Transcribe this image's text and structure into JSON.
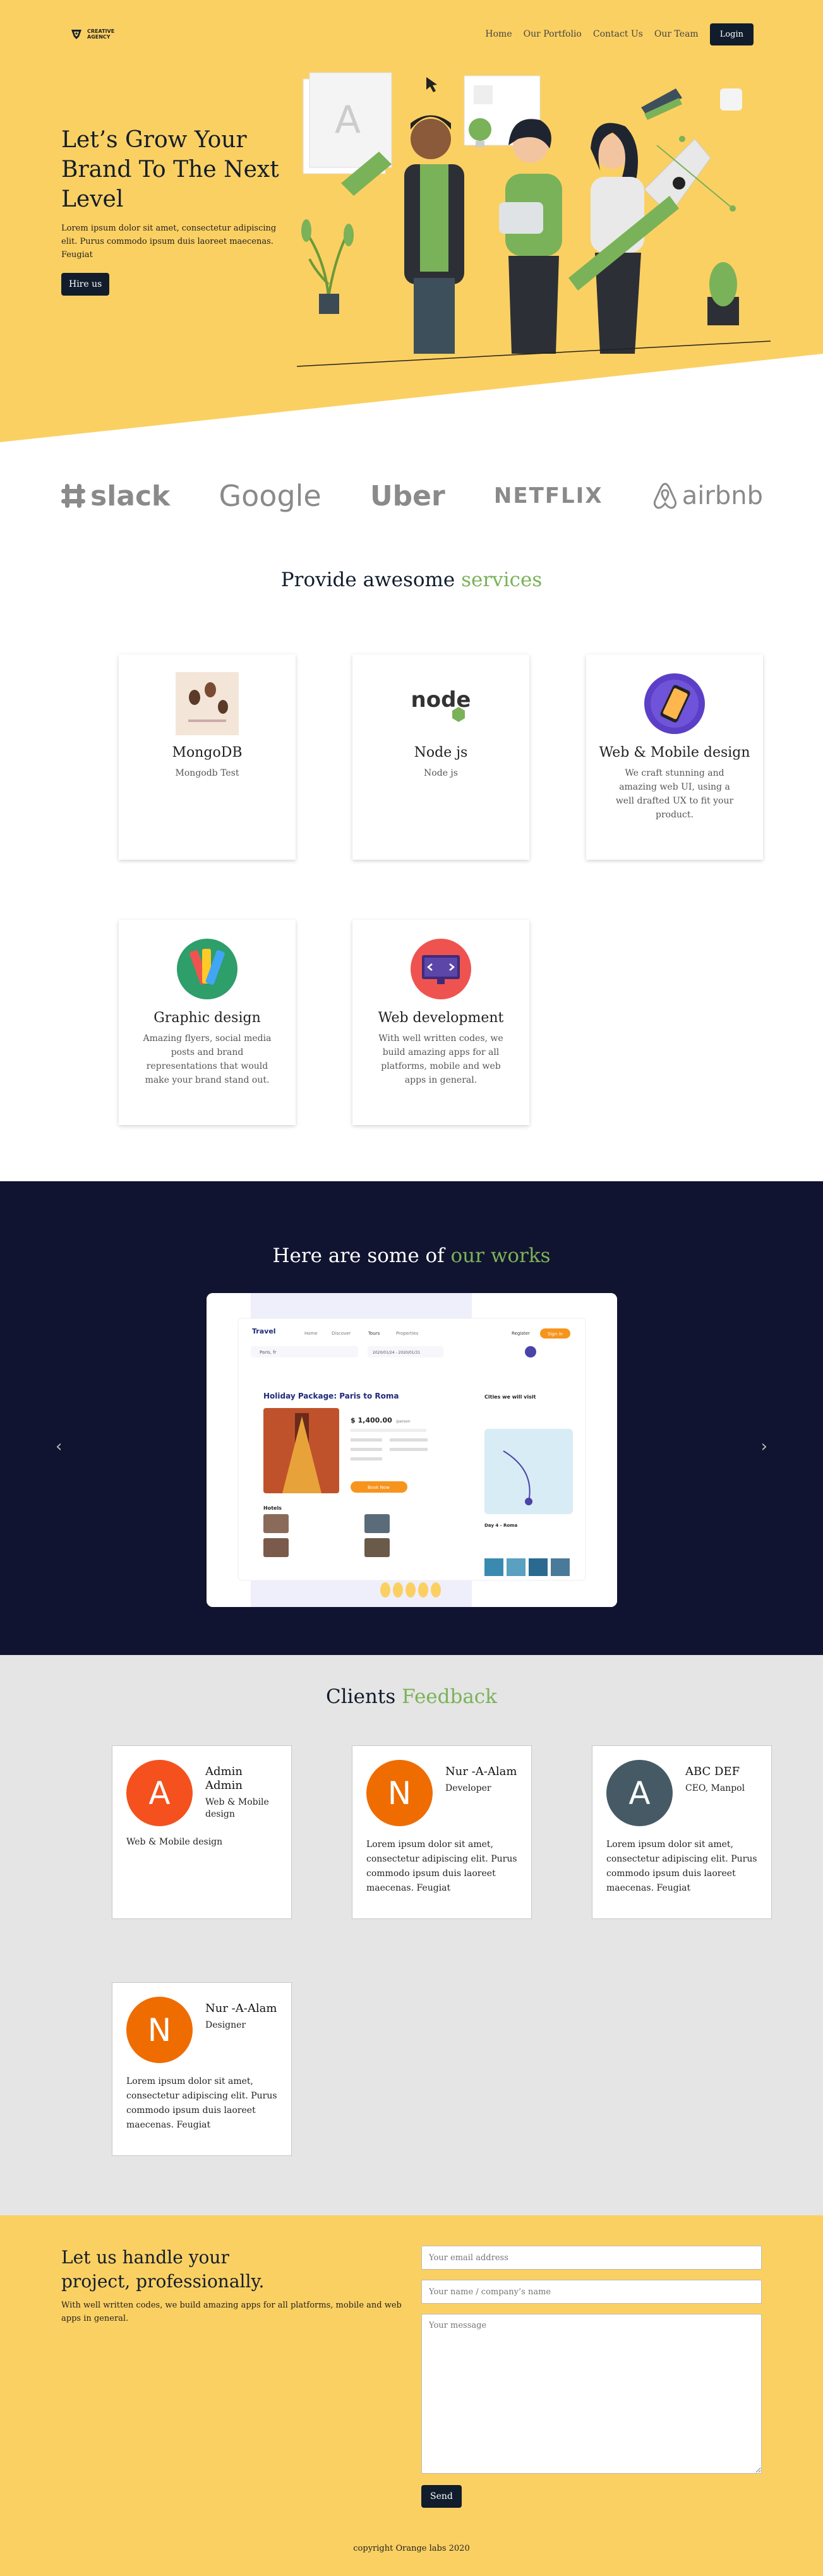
{
  "header": {
    "logo_line1": "CREATIVE",
    "logo_line2": "AGENCY",
    "nav": [
      "Home",
      "Our Portfolio",
      "Contact Us",
      "Our Team"
    ],
    "login_label": "Login"
  },
  "hero": {
    "title": "Let’s Grow Your Brand To The Next Level",
    "text": "Lorem ipsum dolor sit amet, consectetur adipiscing elit. Purus commodo ipsum duis laoreet maecenas. Feugiat",
    "cta_label": "Hire us",
    "art_letter": "A"
  },
  "brands": [
    "slack",
    "Google",
    "Uber",
    "NETFLIX",
    "airbnb"
  ],
  "services": {
    "title_main": "Provide awesome ",
    "title_accent": "services",
    "items": [
      {
        "title": "MongoDB",
        "text": "Mongodb Test",
        "icon": "mongodb-image-icon"
      },
      {
        "title": "Node js",
        "text": "Node js",
        "icon": "nodejs-logo-icon",
        "logo_text": "node"
      },
      {
        "title": "Web & Mobile design",
        "text": "We craft stunning and amazing web UI, using a well drafted UX to fit your product.",
        "icon": "mobile-design-icon"
      },
      {
        "title": "Graphic design",
        "text": "Amazing flyers, social media posts and brand representations that would make your brand stand out.",
        "icon": "palette-icon"
      },
      {
        "title": "Web development",
        "text": "With well written codes, we build amazing apps for all platforms, mobile and web apps in general.",
        "icon": "monitor-code-icon"
      }
    ]
  },
  "works": {
    "title_main": "Here are some of ",
    "title_accent": "our works",
    "prev_label": "‹",
    "next_label": "›",
    "mock": {
      "brand": "Travel",
      "nav": [
        "Home",
        "Discover",
        "Tours",
        "Properties"
      ],
      "register": "Register",
      "signin": "Sign in",
      "search": "Paris, fr",
      "dates": "2020/01/24 - 2020/01/31",
      "package_title": "Holiday Package: Paris to Roma",
      "price": "$ 1,400.00",
      "price_unit": "/person",
      "book": "Book Now",
      "hotels": "Hotels",
      "cities_title": "Cities we will visit",
      "day_title": "Day 4 - Roma"
    }
  },
  "feedback": {
    "title_main": "Clients ",
    "title_accent": "Feedback",
    "items": [
      {
        "initial": "A",
        "color": "#f4511e",
        "name": "Admin Admin",
        "role": "Web & Mobile design",
        "text": "Web & Mobile design"
      },
      {
        "initial": "N",
        "color": "#ef6c00",
        "name": "Nur -A-Alam",
        "role": "Developer",
        "text": "Lorem ipsum dolor sit amet, consectetur adipiscing elit. Purus commodo ipsum duis laoreet maecenas. Feugiat"
      },
      {
        "initial": "A",
        "color": "#455a64",
        "name": "ABC DEF",
        "role": "CEO, Manpol",
        "text": "Lorem ipsum dolor sit amet, consectetur adipiscing elit. Purus commodo ipsum duis laoreet maecenas. Feugiat"
      },
      {
        "initial": "N",
        "color": "#ef6c00",
        "name": "Nur -A-Alam",
        "role": "Designer",
        "text": "Lorem ipsum dolor sit amet, consectetur adipiscing elit. Purus commodo ipsum duis laoreet maecenas. Feugiat"
      }
    ]
  },
  "contact": {
    "title": "Let us handle your project, professionally.",
    "text": "With well written codes, we build amazing apps for all platforms, mobile and web apps in general.",
    "email_placeholder": "Your email address",
    "name_placeholder": "Your name / company’s name",
    "message_placeholder": "Your message",
    "send_label": "Send",
    "copyright": "copyright Orange labs 2020"
  }
}
